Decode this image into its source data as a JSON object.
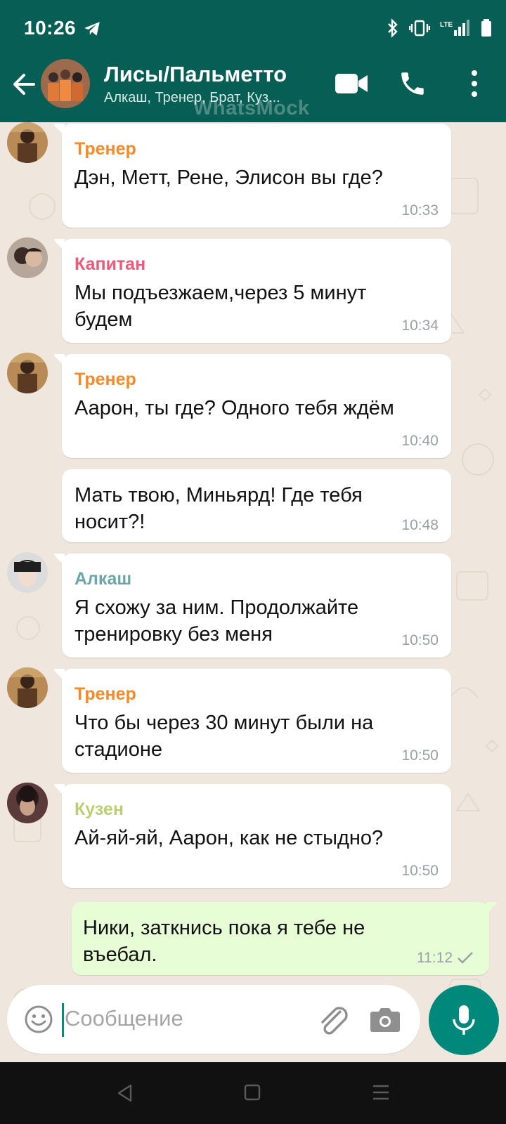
{
  "status_bar": {
    "time": "10:26",
    "net_label": "LTE"
  },
  "header": {
    "title": "Лисы/Пальметто",
    "subtitle": "Алкаш, Тренер, Брат, Куз...",
    "watermark": "WhatsMock"
  },
  "colors": {
    "header_bg": "#075e54",
    "accent": "#00897b",
    "coach": "#f58a28",
    "captain": "#ef5a7a",
    "alkash": "#6aa6a8",
    "cousin": "#b9cf72",
    "outgoing_bubble": "#e7fdd6"
  },
  "messages": [
    {
      "sender": "Тренер",
      "text": "Дэн, Метт, Рене, Элисон вы где?",
      "time": "10:33"
    },
    {
      "sender": "Капитан",
      "text": "Мы подъезжаем,через 5 минут\nбудем",
      "time": "10:34"
    },
    {
      "sender": "Тренер",
      "text": "Аарон, ты где? Одного тебя ждём",
      "time": "10:40"
    },
    {
      "sender": "",
      "text": "Мать твою, Миньярд! Где тебя\nносит?!",
      "time": "10:48"
    },
    {
      "sender": "Алкаш",
      "text": "Я схожу за ним. Продолжайте\nтренировку без меня",
      "time": "10:50"
    },
    {
      "sender": "Тренер",
      "text": "Что бы через 30 минут были на\nстадионе",
      "time": "10:50"
    },
    {
      "sender": "Кузен",
      "text": "Ай-яй-яй, Аарон, как не стыдно?",
      "time": "10:50"
    },
    {
      "sender": "",
      "text": "Ники, заткнись пока я тебе не\nвъебал.",
      "time": "11:12",
      "status": "sent-check-icon"
    }
  ],
  "composer": {
    "placeholder": "Сообщение"
  },
  "icons": {
    "back": "arrow-back-icon",
    "video": "video-call-icon",
    "call": "phone-icon",
    "more": "more-vert-icon",
    "emoji": "emoji-icon",
    "attach": "paperclip-icon",
    "camera": "camera-icon",
    "mic": "mic-icon"
  }
}
